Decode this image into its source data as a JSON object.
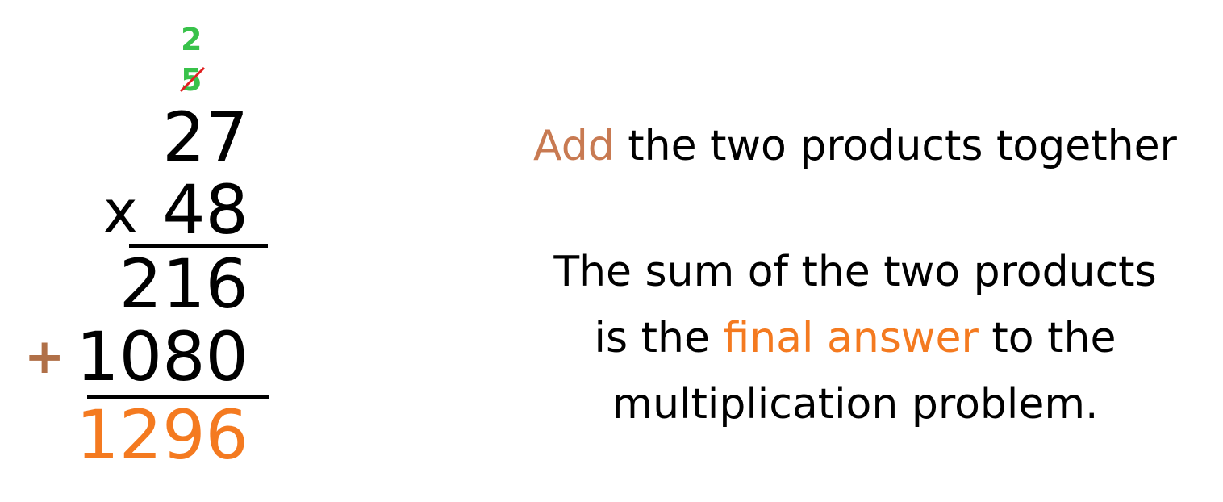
{
  "problem": {
    "carry_new": "2",
    "carry_crossed": "5",
    "multiplicand": "27",
    "multiplier": "48",
    "multiply_sign": "x",
    "partial_product_1": "216",
    "partial_product_2": "1080",
    "add_sign": "+",
    "final_answer": "1296"
  },
  "explanation": {
    "heading_highlight": "Add",
    "heading_rest": " the two products together",
    "line1": "The sum of the two products",
    "line2_start": "is the ",
    "line2_highlight": "final answer",
    "line2_end": " to the",
    "line3": "multiplication problem."
  },
  "colors": {
    "carry": "#38c24a",
    "strike": "#e02020",
    "answer": "#f47a20",
    "add_highlight": "#c87a52",
    "plus_sign": "#b07048"
  }
}
